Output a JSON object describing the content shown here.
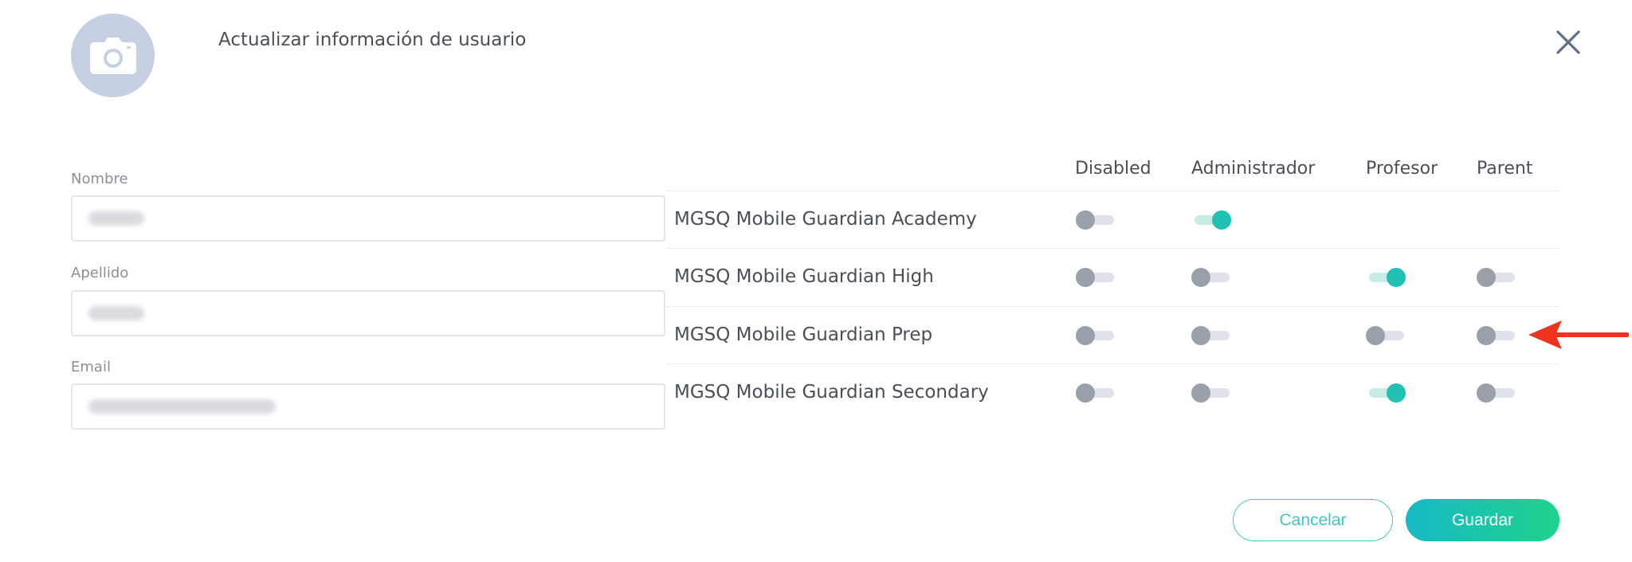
{
  "dialog": {
    "title": "Actualizar información de usuario",
    "avatar_icon": "camera-icon",
    "close_icon": "close-icon"
  },
  "form": {
    "first_name": {
      "label": "Nombre",
      "value_redacted": true
    },
    "last_name": {
      "label": "Apellido",
      "value_redacted": true
    },
    "email": {
      "label": "Email",
      "value_redacted": true
    }
  },
  "roles": {
    "columns": [
      "Disabled",
      "Administrador",
      "Profesor",
      "Parent"
    ],
    "rows": [
      {
        "name": "MGSQ Mobile Guardian Academy",
        "disabled": false,
        "administrador": true,
        "profesor": null,
        "parent": null
      },
      {
        "name": "MGSQ Mobile Guardian High",
        "disabled": false,
        "administrador": false,
        "profesor": true,
        "parent": false
      },
      {
        "name": "MGSQ Mobile Guardian Prep",
        "disabled": false,
        "administrador": false,
        "profesor": false,
        "parent": false
      },
      {
        "name": "MGSQ Mobile Guardian Secondary",
        "disabled": false,
        "administrador": false,
        "profesor": true,
        "parent": false
      }
    ]
  },
  "buttons": {
    "cancel": "Cancelar",
    "save": "Guardar"
  },
  "colors": {
    "accent": "#20c0b4",
    "toggle_off": "#9aa0aa",
    "annotation_arrow": "#f0321e"
  }
}
